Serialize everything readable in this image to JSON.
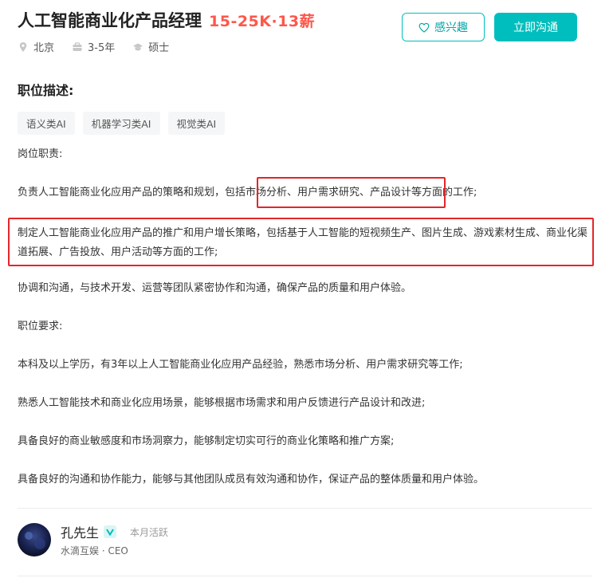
{
  "job": {
    "title": "人工智能商业化产品经理",
    "salary": "15-25K·13薪",
    "location": "北京",
    "experience": "3-5年",
    "degree": "硕士"
  },
  "actions": {
    "interest_label": "感兴趣",
    "chat_label": "立即沟通"
  },
  "description": {
    "section_title": "职位描述:",
    "tags": [
      "语义类AI",
      "机器学习类AI",
      "视觉类AI"
    ],
    "duty_title": "岗位职责:",
    "duty_1": "负责人工智能商业化应用产品的策略和规划，包括市场分析、用户需求研究、产品设计等方面的工作;",
    "duty_2": "制定人工智能商业化应用产品的推广和用户增长策略，包括基于人工智能的短视频生产、图片生成、游戏素材生成、商业化渠道拓展、广告投放、用户活动等方面的工作;",
    "duty_3": "协调和沟通，与技术开发、运营等团队紧密协作和沟通，确保产品的质量和用户体验。",
    "req_title": "职位要求:",
    "req_1": "本科及以上学历，有3年以上人工智能商业化应用产品经验，熟悉市场分析、用户需求研究等工作;",
    "req_2": "熟悉人工智能技术和商业化应用场景，能够根据市场需求和用户反馈进行产品设计和改进;",
    "req_3": "具备良好的商业敏感度和市场洞察力，能够制定切实可行的商业化策略和推广方案;",
    "req_4": "具备良好的沟通和协作能力，能够与其他团队成员有效沟通和协作，保证产品的整体质量和用户体验。"
  },
  "recruiter": {
    "name": "孔先生",
    "activity": "本月活跃",
    "company": "水滴互娱 · CEO"
  },
  "colors": {
    "accent": "#00bebd",
    "salary": "#fe574a",
    "highlight_box": "#e3262a"
  }
}
